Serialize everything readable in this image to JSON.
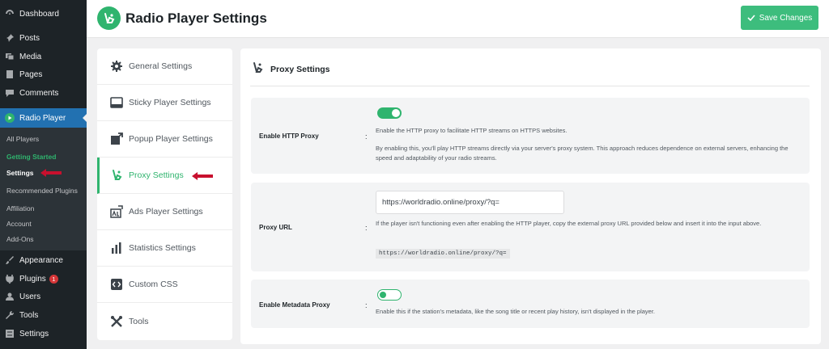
{
  "wp_menu": {
    "dashboard": "Dashboard",
    "posts": "Posts",
    "media": "Media",
    "pages": "Pages",
    "comments": "Comments",
    "radio_player": "Radio Player",
    "submenu": {
      "all_players": "All Players",
      "getting_started": "Getting Started",
      "settings": "Settings",
      "recommended_plugins": "Recommended Plugins",
      "affiliation": "Affiliation",
      "account": "Account",
      "add_ons": "Add-Ons"
    },
    "appearance": "Appearance",
    "plugins": "Plugins",
    "plugins_badge": "1",
    "users": "Users",
    "tools": "Tools",
    "settings": "Settings"
  },
  "header": {
    "title": "Radio Player Settings",
    "save_label": "Save Changes"
  },
  "tabs": [
    {
      "label": "General Settings",
      "icon": "gear-icon"
    },
    {
      "label": "Sticky Player Settings",
      "icon": "sticky-player-icon"
    },
    {
      "label": "Popup Player Settings",
      "icon": "popup-icon"
    },
    {
      "label": "Proxy Settings",
      "icon": "proxy-icon"
    },
    {
      "label": "Ads Player Settings",
      "icon": "ads-icon"
    },
    {
      "label": "Statistics Settings",
      "icon": "bar-chart-icon"
    },
    {
      "label": "Custom CSS",
      "icon": "code-icon"
    },
    {
      "label": "Tools",
      "icon": "tools-icon"
    }
  ],
  "active_tab": "Proxy Settings",
  "section": {
    "title": "Proxy Settings",
    "http_proxy": {
      "label": "Enable HTTP Proxy",
      "enabled": true,
      "desc1": "Enable the HTTP proxy to facilitate HTTP streams on HTTPS websites.",
      "desc2": "By enabling this, you'll play HTTP streams directly via your server's proxy system. This approach reduces dependence on external servers, enhancing the speed and adaptability of your radio streams."
    },
    "proxy_url": {
      "label": "Proxy URL",
      "value": "https://worldradio.online/proxy/?q=",
      "desc": "If the player isn't functioning even after enabling the HTTP player, copy the external proxy URL provided below and insert it into the input above.",
      "code": "https://worldradio.online/proxy/?q="
    },
    "metadata_proxy": {
      "label": "Enable Metadata Proxy",
      "enabled": false,
      "desc": "Enable this if the station's metadata, like the song title or recent play history, isn't displayed in the player."
    }
  },
  "colors": {
    "accent": "#2fb46e",
    "wp_sidebar": "#1d2327",
    "wp_active": "#2271b1",
    "arrow": "#c8102e"
  }
}
